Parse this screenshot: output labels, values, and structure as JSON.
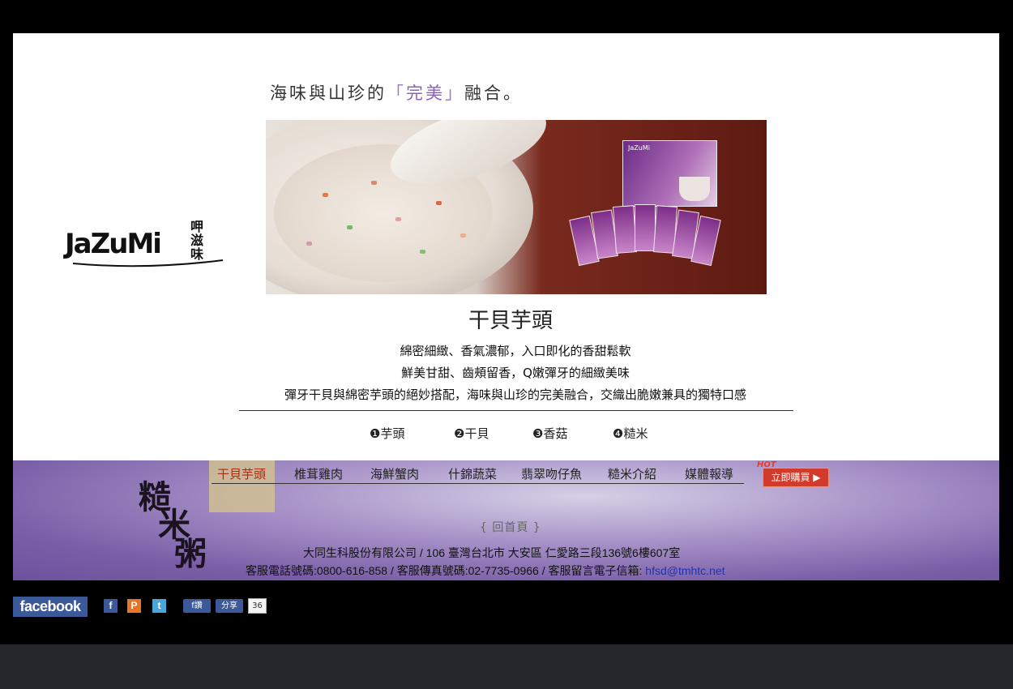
{
  "header": {
    "tagline_pre": "海味與山珍的",
    "bracket_open": "「",
    "tagline_highlight": "完美",
    "bracket_close": "」",
    "tagline_post": "融合。"
  },
  "logo": {
    "wordmark": "JaZuMi",
    "chinese": "呷滋味"
  },
  "product": {
    "title": "干貝芋頭",
    "descriptions": [
      "綿密細緻、香氣濃郁，入口即化的香甜鬆軟",
      "鮮美甘甜、齒頰留香，Q嫩彈牙的細緻美味",
      "彈牙干貝與綿密芋頭的絕妙搭配，海味與山珍的完美融合，交織出脆嫩兼具的獨特口感"
    ],
    "ingredients": [
      "❶芋頭",
      "❷干貝",
      "❸香菇",
      "❹糙米"
    ]
  },
  "hero": {
    "box_label": "JaZuMi"
  },
  "footer": {
    "brand_calligraphy": [
      "糙",
      "米",
      "粥"
    ],
    "nav": [
      "干貝芋頭",
      "椎茸雞肉",
      "海鮮蟹肉",
      "什錦蔬菜",
      "翡翠吻仔魚",
      "糙米介紹",
      "媒體報導"
    ],
    "hot_tag": "HOT",
    "hot_button": "立即購買 ▶",
    "home_link": "{ 回首頁 }",
    "address": "大同生科股份有限公司 / 106 臺灣台北市 大安區 仁愛路三段136號6樓607室",
    "contact_prefix": "客服電話號碼:0800-616-858 / 客服傳真號碼:02-7735-0966 / 客服留言電子信箱: ",
    "email": "hfsd@tmhtc.net"
  },
  "social": {
    "facebook": "facebook",
    "fb_icon": "f",
    "plurk_icon": "P",
    "twitter_icon": "t",
    "share_fb": "f讚",
    "share_label": "分享",
    "count": "36"
  },
  "colors": {
    "purple_accent": "#8a63b8",
    "nav_active": "#b02a10",
    "facebook_blue": "#3b5998"
  }
}
